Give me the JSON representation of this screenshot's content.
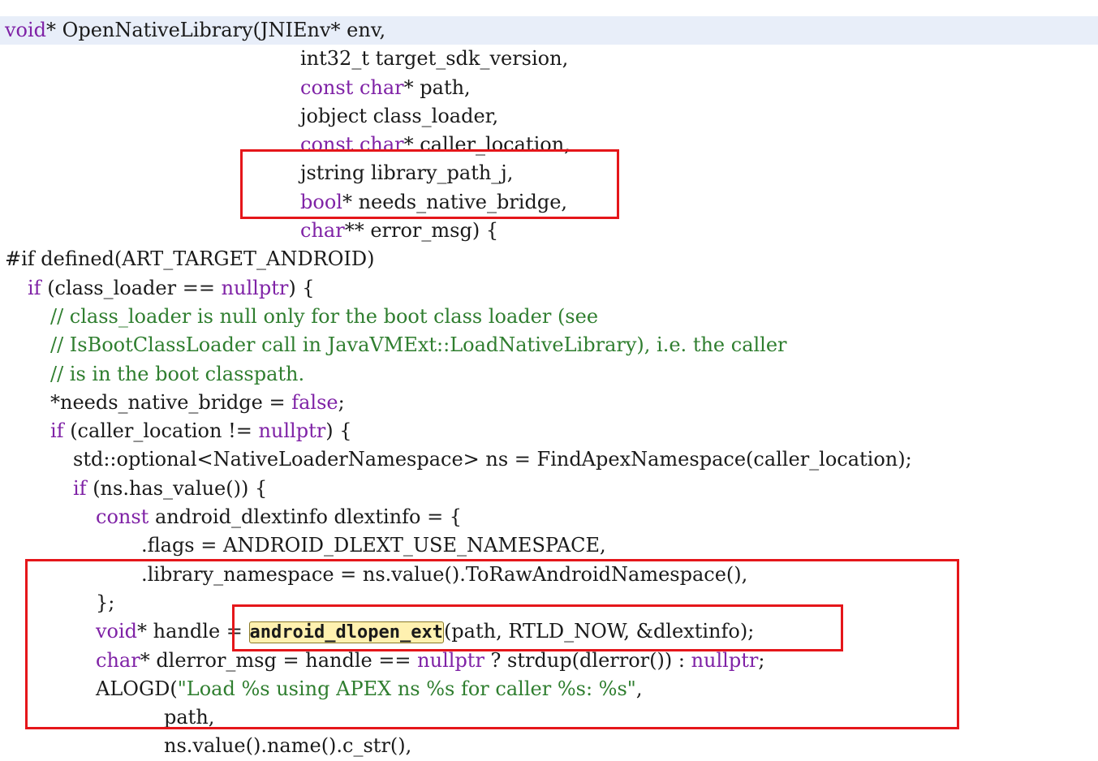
{
  "lines": [
    {
      "indent": 0,
      "current": true,
      "tokens": [
        {
          "t": "void",
          "c": "kw"
        },
        {
          "t": "* OpenNativeLibrary(JNIEnv* env,",
          "c": ""
        }
      ]
    },
    {
      "indent": 13,
      "tokens": [
        {
          "t": "int32_t target_sdk_version,",
          "c": ""
        }
      ]
    },
    {
      "indent": 13,
      "tokens": [
        {
          "t": "const",
          "c": "kw"
        },
        {
          "t": " ",
          "c": ""
        },
        {
          "t": "char",
          "c": "kw"
        },
        {
          "t": "* path,",
          "c": ""
        }
      ]
    },
    {
      "indent": 13,
      "tokens": [
        {
          "t": "jobject class_loader,",
          "c": ""
        }
      ]
    },
    {
      "indent": 13,
      "tokens": [
        {
          "t": "const",
          "c": "kw"
        },
        {
          "t": " ",
          "c": ""
        },
        {
          "t": "char",
          "c": "kw"
        },
        {
          "t": "* caller_location,",
          "c": ""
        }
      ]
    },
    {
      "indent": 13,
      "tokens": [
        {
          "t": "jstring library_path_j,",
          "c": ""
        }
      ]
    },
    {
      "indent": 13,
      "tokens": [
        {
          "t": "bool",
          "c": "kw"
        },
        {
          "t": "* needs_native_bridge,",
          "c": ""
        }
      ]
    },
    {
      "indent": 13,
      "tokens": [
        {
          "t": "char",
          "c": "kw"
        },
        {
          "t": "** error_msg) {",
          "c": ""
        }
      ]
    },
    {
      "indent": 0,
      "tokens": [
        {
          "t": "#if defined(ART_TARGET_ANDROID)",
          "c": "pp"
        }
      ]
    },
    {
      "indent": 1,
      "tokens": [
        {
          "t": "if",
          "c": "kw"
        },
        {
          "t": " (class_loader == ",
          "c": ""
        },
        {
          "t": "nullptr",
          "c": "kw"
        },
        {
          "t": ") {",
          "c": ""
        }
      ]
    },
    {
      "indent": 2,
      "tokens": [
        {
          "t": "// class_loader is null only for the boot class loader (see",
          "c": "cm"
        }
      ]
    },
    {
      "indent": 2,
      "tokens": [
        {
          "t": "// IsBootClassLoader call in JavaVMExt::LoadNativeLibrary), i.e. the caller",
          "c": "cm"
        }
      ]
    },
    {
      "indent": 2,
      "tokens": [
        {
          "t": "// is in the boot classpath.",
          "c": "cm"
        }
      ]
    },
    {
      "indent": 2,
      "tokens": [
        {
          "t": "*needs_native_bridge = ",
          "c": ""
        },
        {
          "t": "false",
          "c": "kw"
        },
        {
          "t": ";",
          "c": ""
        }
      ]
    },
    {
      "indent": 2,
      "tokens": [
        {
          "t": "if",
          "c": "kw"
        },
        {
          "t": " (caller_location != ",
          "c": ""
        },
        {
          "t": "nullptr",
          "c": "kw"
        },
        {
          "t": ") {",
          "c": ""
        }
      ]
    },
    {
      "indent": 3,
      "tokens": [
        {
          "t": "std::optional<NativeLoaderNamespace> ns = FindApexNamespace(caller_location);",
          "c": ""
        }
      ]
    },
    {
      "indent": 3,
      "tokens": [
        {
          "t": "if",
          "c": "kw"
        },
        {
          "t": " (ns.has_value()) {",
          "c": ""
        }
      ]
    },
    {
      "indent": 4,
      "tokens": [
        {
          "t": "const",
          "c": "kw"
        },
        {
          "t": " android_dlextinfo dlextinfo = {",
          "c": ""
        }
      ]
    },
    {
      "indent": 6,
      "tokens": [
        {
          "t": ".flags = ANDROID_DLEXT_USE_NAMESPACE,",
          "c": ""
        }
      ]
    },
    {
      "indent": 6,
      "tokens": [
        {
          "t": ".library_namespace = ns.value().ToRawAndroidNamespace(),",
          "c": ""
        }
      ]
    },
    {
      "indent": 4,
      "tokens": [
        {
          "t": "};",
          "c": ""
        }
      ]
    },
    {
      "indent": 4,
      "tokens": [
        {
          "t": "void",
          "c": "kw"
        },
        {
          "t": "* handle = ",
          "c": ""
        },
        {
          "t": "android_dlopen_ext",
          "c": "hl"
        },
        {
          "t": "(path, RTLD_NOW, &dlextinfo);",
          "c": ""
        }
      ]
    },
    {
      "indent": 4,
      "tokens": [
        {
          "t": "char",
          "c": "kw"
        },
        {
          "t": "* dlerror_msg = handle == ",
          "c": ""
        },
        {
          "t": "nullptr",
          "c": "kw"
        },
        {
          "t": " ? strdup(dlerror()) : ",
          "c": ""
        },
        {
          "t": "nullptr",
          "c": "kw"
        },
        {
          "t": ";",
          "c": ""
        }
      ]
    },
    {
      "indent": 4,
      "tokens": [
        {
          "t": "ALOGD(",
          "c": ""
        },
        {
          "t": "\"Load %s using APEX ns %s for caller %s: %s\"",
          "c": "st"
        },
        {
          "t": ",",
          "c": ""
        }
      ]
    },
    {
      "indent": 7,
      "tokens": [
        {
          "t": "path,",
          "c": ""
        }
      ]
    },
    {
      "indent": 7,
      "tokens": [
        {
          "t": "ns.value().name().c_str(),",
          "c": ""
        }
      ]
    }
  ]
}
